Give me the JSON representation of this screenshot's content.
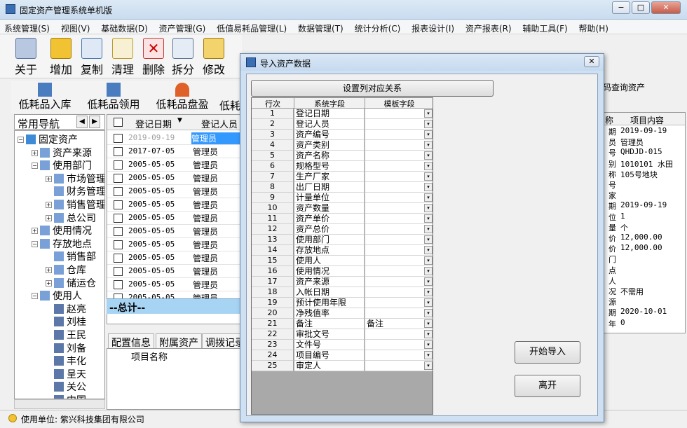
{
  "window": {
    "title": "固定资产管理系统单机版",
    "min": "−",
    "max": "□",
    "close": "✕"
  },
  "menu": [
    "系统管理(S)",
    "视图(V)",
    "基础数据(D)",
    "资产管理(G)",
    "低值易耗品管理(L)",
    "数据管理(T)",
    "统计分析(C)",
    "报表设计(I)",
    "资产报表(R)",
    "辅助工具(F)",
    "帮助(H)"
  ],
  "toolbar": [
    "关于",
    "增加",
    "复制",
    "清理",
    "删除",
    "拆分",
    "修改"
  ],
  "toolbar2": [
    "低耗品入库",
    "低耗品领用",
    "低耗品盘盈",
    "低耗"
  ],
  "nav": {
    "title": "常用导航",
    "prev": "◀",
    "next": "▶",
    "tree": [
      {
        "label": "固定资产",
        "level": 0,
        "tog": "−"
      },
      {
        "label": "资产来源",
        "level": 1,
        "tog": "+"
      },
      {
        "label": "使用部门",
        "level": 1,
        "tog": "−"
      },
      {
        "label": "市场管理",
        "level": 2,
        "tog": "+"
      },
      {
        "label": "财务管理",
        "level": 2,
        "tog": ""
      },
      {
        "label": "销售管理",
        "level": 2,
        "tog": "+"
      },
      {
        "label": "总公司",
        "level": 2,
        "tog": "+"
      },
      {
        "label": "使用情况",
        "level": 1,
        "tog": "+"
      },
      {
        "label": "存放地点",
        "level": 1,
        "tog": "−"
      },
      {
        "label": "销售部",
        "level": 2,
        "tog": ""
      },
      {
        "label": "仓库",
        "level": 2,
        "tog": "+"
      },
      {
        "label": "储运仓",
        "level": 2,
        "tog": "+"
      },
      {
        "label": "使用人",
        "level": 1,
        "tog": "−"
      },
      {
        "label": "赵亮",
        "level": 2,
        "tog": ""
      },
      {
        "label": "刘桂",
        "level": 2,
        "tog": ""
      },
      {
        "label": "王民",
        "level": 2,
        "tog": ""
      },
      {
        "label": "刘备",
        "level": 2,
        "tog": ""
      },
      {
        "label": "丰化",
        "level": 2,
        "tog": ""
      },
      {
        "label": "呈天",
        "level": 2,
        "tog": ""
      },
      {
        "label": "关公",
        "level": 2,
        "tog": ""
      },
      {
        "label": "中国",
        "level": 2,
        "tog": ""
      }
    ]
  },
  "grid": {
    "col_date": "登记日期",
    "col_user": "登记人员",
    "rows": [
      {
        "date": "2019-09-19",
        "user": "管理员"
      },
      {
        "date": "2017-07-05",
        "user": "管理员"
      },
      {
        "date": "2005-05-05",
        "user": "管理员"
      },
      {
        "date": "2005-05-05",
        "user": "管理员"
      },
      {
        "date": "2005-05-05",
        "user": "管理员"
      },
      {
        "date": "2005-05-05",
        "user": "管理员"
      },
      {
        "date": "2005-05-05",
        "user": "管理员"
      },
      {
        "date": "2005-05-05",
        "user": "管理员"
      },
      {
        "date": "2005-05-05",
        "user": "管理员"
      },
      {
        "date": "2005-05-05",
        "user": "管理员"
      },
      {
        "date": "2005-05-05",
        "user": "管理员"
      },
      {
        "date": "2005-05-05",
        "user": "管理员"
      },
      {
        "date": "2005-05-05",
        "user": "管理员"
      }
    ],
    "total": "--总计--"
  },
  "tabs": [
    "配置信息",
    "附属资产",
    "调拨记录"
  ],
  "subgrid_header": "项目名称",
  "right": {
    "title": "码查询资产",
    "col_name": "称",
    "col_value": "项目内容",
    "rows": [
      {
        "k": "期",
        "v": "2019-09-19"
      },
      {
        "k": "员",
        "v": "管理员"
      },
      {
        "k": "号",
        "v": "QHDJD-015"
      },
      {
        "k": "别",
        "v": "1010101 水田"
      },
      {
        "k": "称",
        "v": "105号地块"
      },
      {
        "k": "号",
        "v": ""
      },
      {
        "k": "家",
        "v": ""
      },
      {
        "k": "期",
        "v": "2019-09-19"
      },
      {
        "k": "位",
        "v": "1"
      },
      {
        "k": "量",
        "v": "个"
      },
      {
        "k": "价",
        "v": "12,000.00"
      },
      {
        "k": "价",
        "v": "12,000.00"
      },
      {
        "k": "门",
        "v": ""
      },
      {
        "k": "点",
        "v": ""
      },
      {
        "k": "人",
        "v": ""
      },
      {
        "k": "况",
        "v": "不需用"
      },
      {
        "k": "源",
        "v": ""
      },
      {
        "k": "期",
        "v": "2020-10-01"
      },
      {
        "k": "年",
        "v": "0"
      }
    ]
  },
  "status": "使用单位: 紫兴科技集团有限公司",
  "dialog": {
    "title": "导入资产数据",
    "close": "✕",
    "map_button": "设置列对应关系",
    "col_row": "行次",
    "col_sys": "系统字段",
    "col_tpl": "模板字段",
    "dd_arrow": "▾",
    "rows": [
      {
        "n": "1",
        "sys": "登记日期",
        "tpl": ""
      },
      {
        "n": "2",
        "sys": "登记人员",
        "tpl": ""
      },
      {
        "n": "3",
        "sys": "资产编号",
        "tpl": ""
      },
      {
        "n": "4",
        "sys": "资产类别",
        "tpl": ""
      },
      {
        "n": "5",
        "sys": "资产名称",
        "tpl": ""
      },
      {
        "n": "6",
        "sys": "规格型号",
        "tpl": ""
      },
      {
        "n": "7",
        "sys": "生产厂家",
        "tpl": ""
      },
      {
        "n": "8",
        "sys": "出厂日期",
        "tpl": ""
      },
      {
        "n": "9",
        "sys": "计量单位",
        "tpl": ""
      },
      {
        "n": "10",
        "sys": "资产数量",
        "tpl": ""
      },
      {
        "n": "11",
        "sys": "资产单价",
        "tpl": ""
      },
      {
        "n": "12",
        "sys": "资产总价",
        "tpl": ""
      },
      {
        "n": "13",
        "sys": "使用部门",
        "tpl": ""
      },
      {
        "n": "14",
        "sys": "存放地点",
        "tpl": ""
      },
      {
        "n": "15",
        "sys": "使用人",
        "tpl": ""
      },
      {
        "n": "16",
        "sys": "使用情况",
        "tpl": ""
      },
      {
        "n": "17",
        "sys": "资产来源",
        "tpl": ""
      },
      {
        "n": "18",
        "sys": "入帐日期",
        "tpl": ""
      },
      {
        "n": "19",
        "sys": "预计使用年限",
        "tpl": ""
      },
      {
        "n": "20",
        "sys": "净残值率",
        "tpl": ""
      },
      {
        "n": "21",
        "sys": "备注",
        "tpl": "备注"
      },
      {
        "n": "22",
        "sys": "审批文号",
        "tpl": ""
      },
      {
        "n": "23",
        "sys": "文件号",
        "tpl": ""
      },
      {
        "n": "24",
        "sys": "项目编号",
        "tpl": ""
      },
      {
        "n": "25",
        "sys": "审定人",
        "tpl": ""
      }
    ],
    "start_button": "开始导入",
    "leave_button": "离开"
  }
}
